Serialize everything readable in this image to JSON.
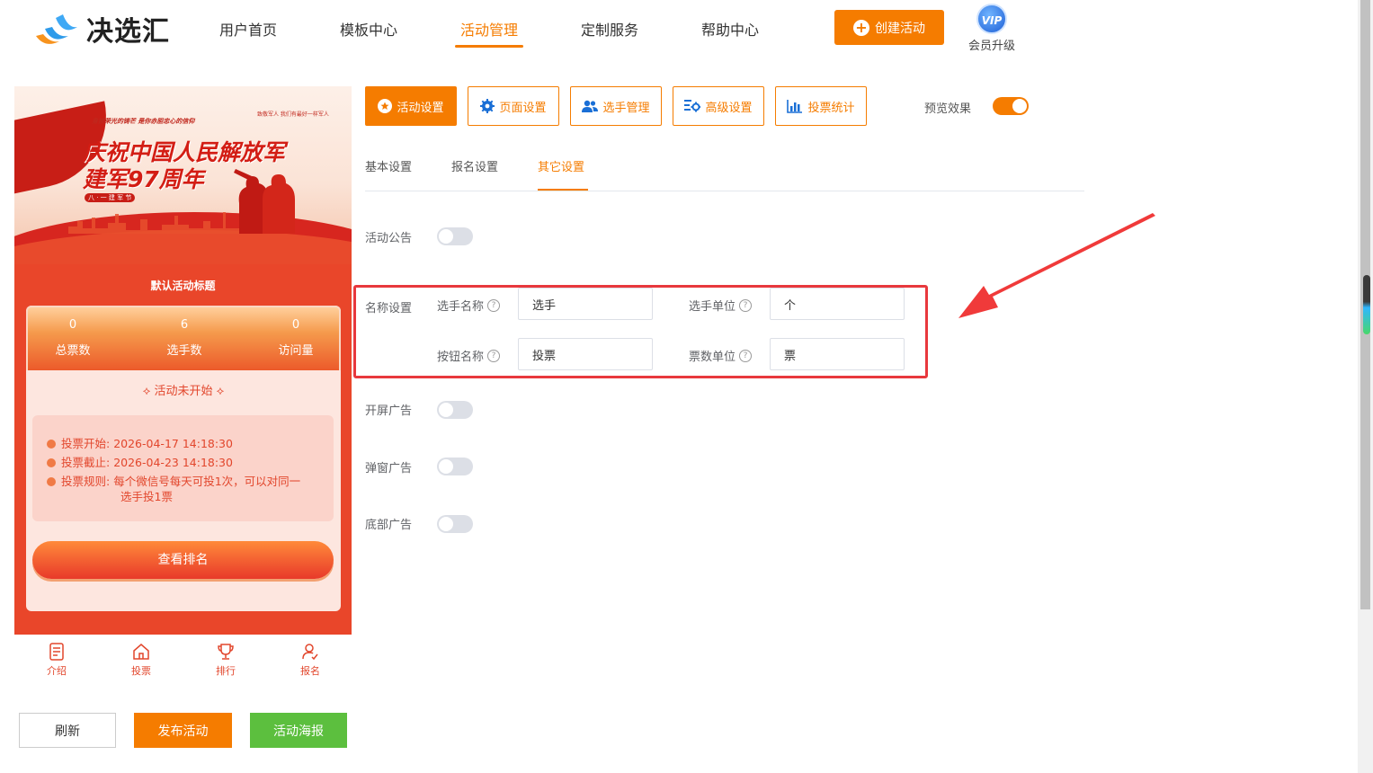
{
  "header": {
    "logo_text": "决选汇",
    "nav": [
      "用户首页",
      "模板中心",
      "活动管理",
      "定制服务",
      "帮助中心"
    ],
    "active_nav": "活动管理",
    "create_button": "创建活动",
    "vip_badge": "VIP",
    "vip_label": "会员升级"
  },
  "preview": {
    "banner_slogan": "身披荣光的铸芒 是你赤胆忠心的信仰",
    "banner_slogan2": "致敬军人 我们有最好一样军人",
    "banner_title_line1": "庆祝中国人民解放军",
    "banner_title_line2": "建军97周年",
    "banner_tag": "八 · 一 建 军 节",
    "activity_title": "默认活动标题",
    "stats": [
      {
        "value": "0",
        "label": "总票数"
      },
      {
        "value": "6",
        "label": "选手数"
      },
      {
        "value": "0",
        "label": "访问量"
      }
    ],
    "status": "活动未开始",
    "info": {
      "start_label": "投票开始:",
      "start_value": "2026-04-17 14:18:30",
      "end_label": "投票截止:",
      "end_value": "2026-04-23 14:18:30",
      "rule_label": "投票规则:",
      "rule_value_line1": "每个微信号每天可投1次，可以对同一",
      "rule_value_line2": "选手投1票"
    },
    "rank_button": "查看排名",
    "tabbar": [
      "介绍",
      "投票",
      "排行",
      "报名"
    ]
  },
  "actions": {
    "refresh": "刷新",
    "publish": "发布活动",
    "poster": "活动海报"
  },
  "toolbar": {
    "buttons": [
      "活动设置",
      "页面设置",
      "选手管理",
      "高级设置",
      "投票统计"
    ],
    "active": "活动设置",
    "preview_label": "预览效果",
    "preview_on": true
  },
  "subtabs": [
    "基本设置",
    "报名设置",
    "其它设置"
  ],
  "active_subtab": "其它设置",
  "settings": {
    "announcement_label": "活动公告",
    "announcement_on": false,
    "name_settings_label": "名称设置",
    "player_name_label": "选手名称",
    "player_name_value": "选手",
    "player_unit_label": "选手单位",
    "player_unit_value": "个",
    "button_name_label": "按钮名称",
    "button_name_value": "投票",
    "vote_unit_label": "票数单位",
    "vote_unit_value": "票",
    "splash_ad_label": "开屏广告",
    "splash_ad_on": false,
    "popup_ad_label": "弹窗广告",
    "popup_ad_on": false,
    "bottom_ad_label": "底部广告",
    "bottom_ad_on": false
  },
  "colors": {
    "accent": "#f57c00",
    "highlight": "#e8383d",
    "success": "#5cbf3e"
  }
}
